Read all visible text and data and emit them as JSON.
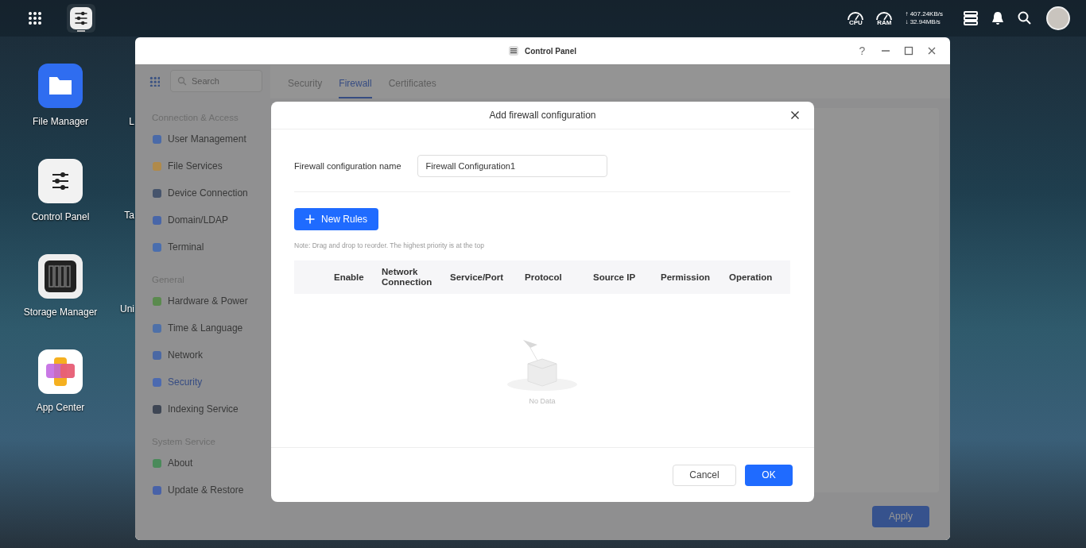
{
  "topbar": {
    "apps": [
      {
        "kind": "launcher",
        "active": false
      },
      {
        "kind": "control_panel",
        "active": true
      }
    ],
    "gauges": [
      {
        "label": "CPU"
      },
      {
        "label": "RAM"
      }
    ],
    "upload": "↑ 407.24KB/s",
    "download": "↓ 32.94MB/s"
  },
  "desktop": {
    "icons": [
      {
        "kind": "folder",
        "label": "File Manager"
      },
      {
        "kind": "sliders",
        "label": "Control Panel"
      },
      {
        "kind": "storage",
        "label": "Storage Manager"
      },
      {
        "kind": "apps",
        "label": "App Center"
      }
    ],
    "cut_labels": [
      "L",
      "Ta",
      "Uni"
    ]
  },
  "window": {
    "title": "Control Panel",
    "help_label": "?",
    "search": {
      "placeholder": "Search"
    },
    "sidebar": [
      {
        "kind": "header",
        "label": "Connection & Access"
      },
      {
        "kind": "item",
        "label": "User Management",
        "color": "#4a6aa8",
        "selected": false
      },
      {
        "kind": "item",
        "label": "File Services",
        "color": "#b08a4a",
        "selected": false
      },
      {
        "kind": "item",
        "label": "Device Connection",
        "color": "#46546c",
        "selected": false
      },
      {
        "kind": "item",
        "label": "Domain/LDAP",
        "color": "#4866a8",
        "selected": false
      },
      {
        "kind": "item",
        "label": "Terminal",
        "color": "#4a6eae",
        "selected": false
      },
      {
        "kind": "header",
        "label": "General"
      },
      {
        "kind": "item",
        "label": "Hardware & Power",
        "color": "#5a8a4e",
        "selected": false
      },
      {
        "kind": "item",
        "label": "Time & Language",
        "color": "#4e70a8",
        "selected": false
      },
      {
        "kind": "item",
        "label": "Network",
        "color": "#4a68a4",
        "selected": false
      },
      {
        "kind": "item",
        "label": "Security",
        "color": "#4c6ab0",
        "selected": true
      },
      {
        "kind": "item",
        "label": "Indexing Service",
        "color": "#3e4654",
        "selected": false
      },
      {
        "kind": "header",
        "label": "System Service"
      },
      {
        "kind": "item",
        "label": "About",
        "color": "#4a8a5a",
        "selected": false
      },
      {
        "kind": "item",
        "label": "Update & Restore",
        "color": "#4862a8",
        "selected": false
      }
    ],
    "tabs": [
      {
        "label": "Security",
        "selected": false
      },
      {
        "label": "Firewall",
        "selected": true
      },
      {
        "label": "Certificates",
        "selected": false
      }
    ],
    "apply_button": "Apply"
  },
  "dialog": {
    "title": "Add firewall configuration",
    "name_label": "Firewall configuration name",
    "name_value": "Firewall Configuration1",
    "new_rules_button": "New Rules",
    "note": "Note: Drag and drop to reorder. The highest priority is at the top",
    "columns": [
      "Enable",
      "Network Connection",
      "Service/Port",
      "Protocol",
      "Source IP",
      "Permission",
      "Operation"
    ],
    "empty_text": "No Data",
    "buttons": [
      {
        "kind": "secondary",
        "label": "Cancel"
      },
      {
        "kind": "primary",
        "label": "OK"
      }
    ]
  }
}
